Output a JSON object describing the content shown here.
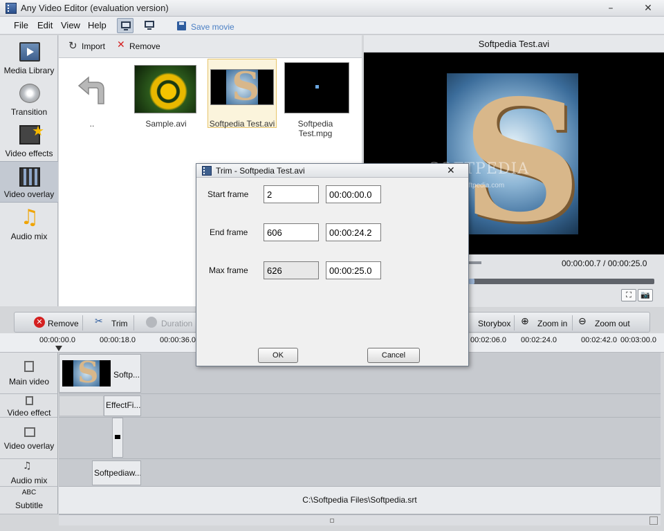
{
  "window": {
    "title": "Any Video Editor (evaluation version)",
    "minimize": "–",
    "close": "✕"
  },
  "menu": {
    "items": [
      "File",
      "Edit",
      "View",
      "Help"
    ],
    "save_movie": "Save movie"
  },
  "left_panel": {
    "items": [
      "Media Library",
      "Transition",
      "Video effects",
      "Video overlay",
      "Audio mix"
    ],
    "active": "Video overlay"
  },
  "media_toolbar": {
    "import": "Import",
    "remove": "Remove"
  },
  "media_items": [
    {
      "label": "..",
      "kind": "back"
    },
    {
      "label": "Sample.avi",
      "kind": "flower"
    },
    {
      "label": "Softpedia Test.avi",
      "kind": "s-logo",
      "selected": true
    },
    {
      "label": "Softpedia Test.mpg",
      "kind": "dark"
    }
  ],
  "preview": {
    "title": "Softpedia Test.avi",
    "watermark": "SOFTPEDIA",
    "watermark_url": "www.softpedia.com",
    "time": "00:00:00.7 / 00:00:25.0",
    "seek_fraction": 0.03
  },
  "timeline_toolbar": {
    "remove": "Remove",
    "trim": "Trim",
    "duration": "Duration",
    "storybox": "Storybox",
    "zoom_in": "Zoom in",
    "zoom_out": "Zoom out"
  },
  "ruler": {
    "ticks": [
      "00:00:00.0",
      "00:00:18.0",
      "00:00:36.0",
      "00:02:06.0",
      "00:02:24.0",
      "00:02:42.0",
      "00:03:00.0"
    ]
  },
  "tracks": {
    "main_video": {
      "label": "Main video",
      "clip": "Softp..."
    },
    "video_effect": {
      "label": "Video effect",
      "clip": "EffectFi..."
    },
    "video_overlay": {
      "label": "Video overlay"
    },
    "audio_mix": {
      "label": "Audio mix",
      "clip": "Softpediaw..."
    },
    "subtitle": {
      "label": "Subtitle",
      "abc": "ABC",
      "file": "C:\\Softpedia Files\\Softpedia.srt"
    }
  },
  "trim_dialog": {
    "title": "Trim - Softpedia Test.avi",
    "start_label": "Start frame",
    "start_frame": "2",
    "start_time": "00:00:00.0",
    "end_label": "End frame",
    "end_frame": "606",
    "end_time": "00:00:24.2",
    "max_label": "Max frame",
    "max_frame": "626",
    "max_time": "00:00:25.0",
    "ok": "OK",
    "cancel": "Cancel"
  }
}
